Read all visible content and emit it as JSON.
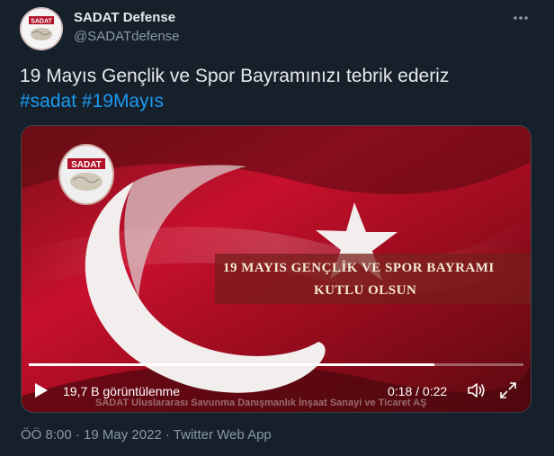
{
  "account": {
    "name": "SADAT Defense",
    "handle": "@SADATdefense",
    "avatar_text": "SADAT"
  },
  "more_icon": "more-dots-icon",
  "tweet": {
    "text": "19 Mayıs Gençlik ve Spor Bayramınızı tebrik ederiz",
    "hashtags": [
      "#sadat",
      "#19Mayıs"
    ]
  },
  "video": {
    "banner_line1": "19 MAYIS GENÇLİK VE SPOR BAYRAMI",
    "banner_line2": "KUTLU OLSUN",
    "logo_text": "SADAT",
    "views": "19,7 B görüntülenme",
    "time": "0:18 / 0:22",
    "progress": 0.82,
    "watermark": "SADAT Uluslararası Savunma Danışmanlık İnşaat Sanayi ve Ticaret AŞ",
    "icons": [
      "play-icon",
      "volume-icon",
      "fullscreen-icon"
    ]
  },
  "meta": {
    "time": "ÖÖ 8:00 · 19 May 2022 · Twitter Web App"
  },
  "colors": {
    "background": "#15202b",
    "link": "#1d9bf0",
    "secondary_text": "#8b98a5",
    "flag_red": "#c8102e"
  }
}
